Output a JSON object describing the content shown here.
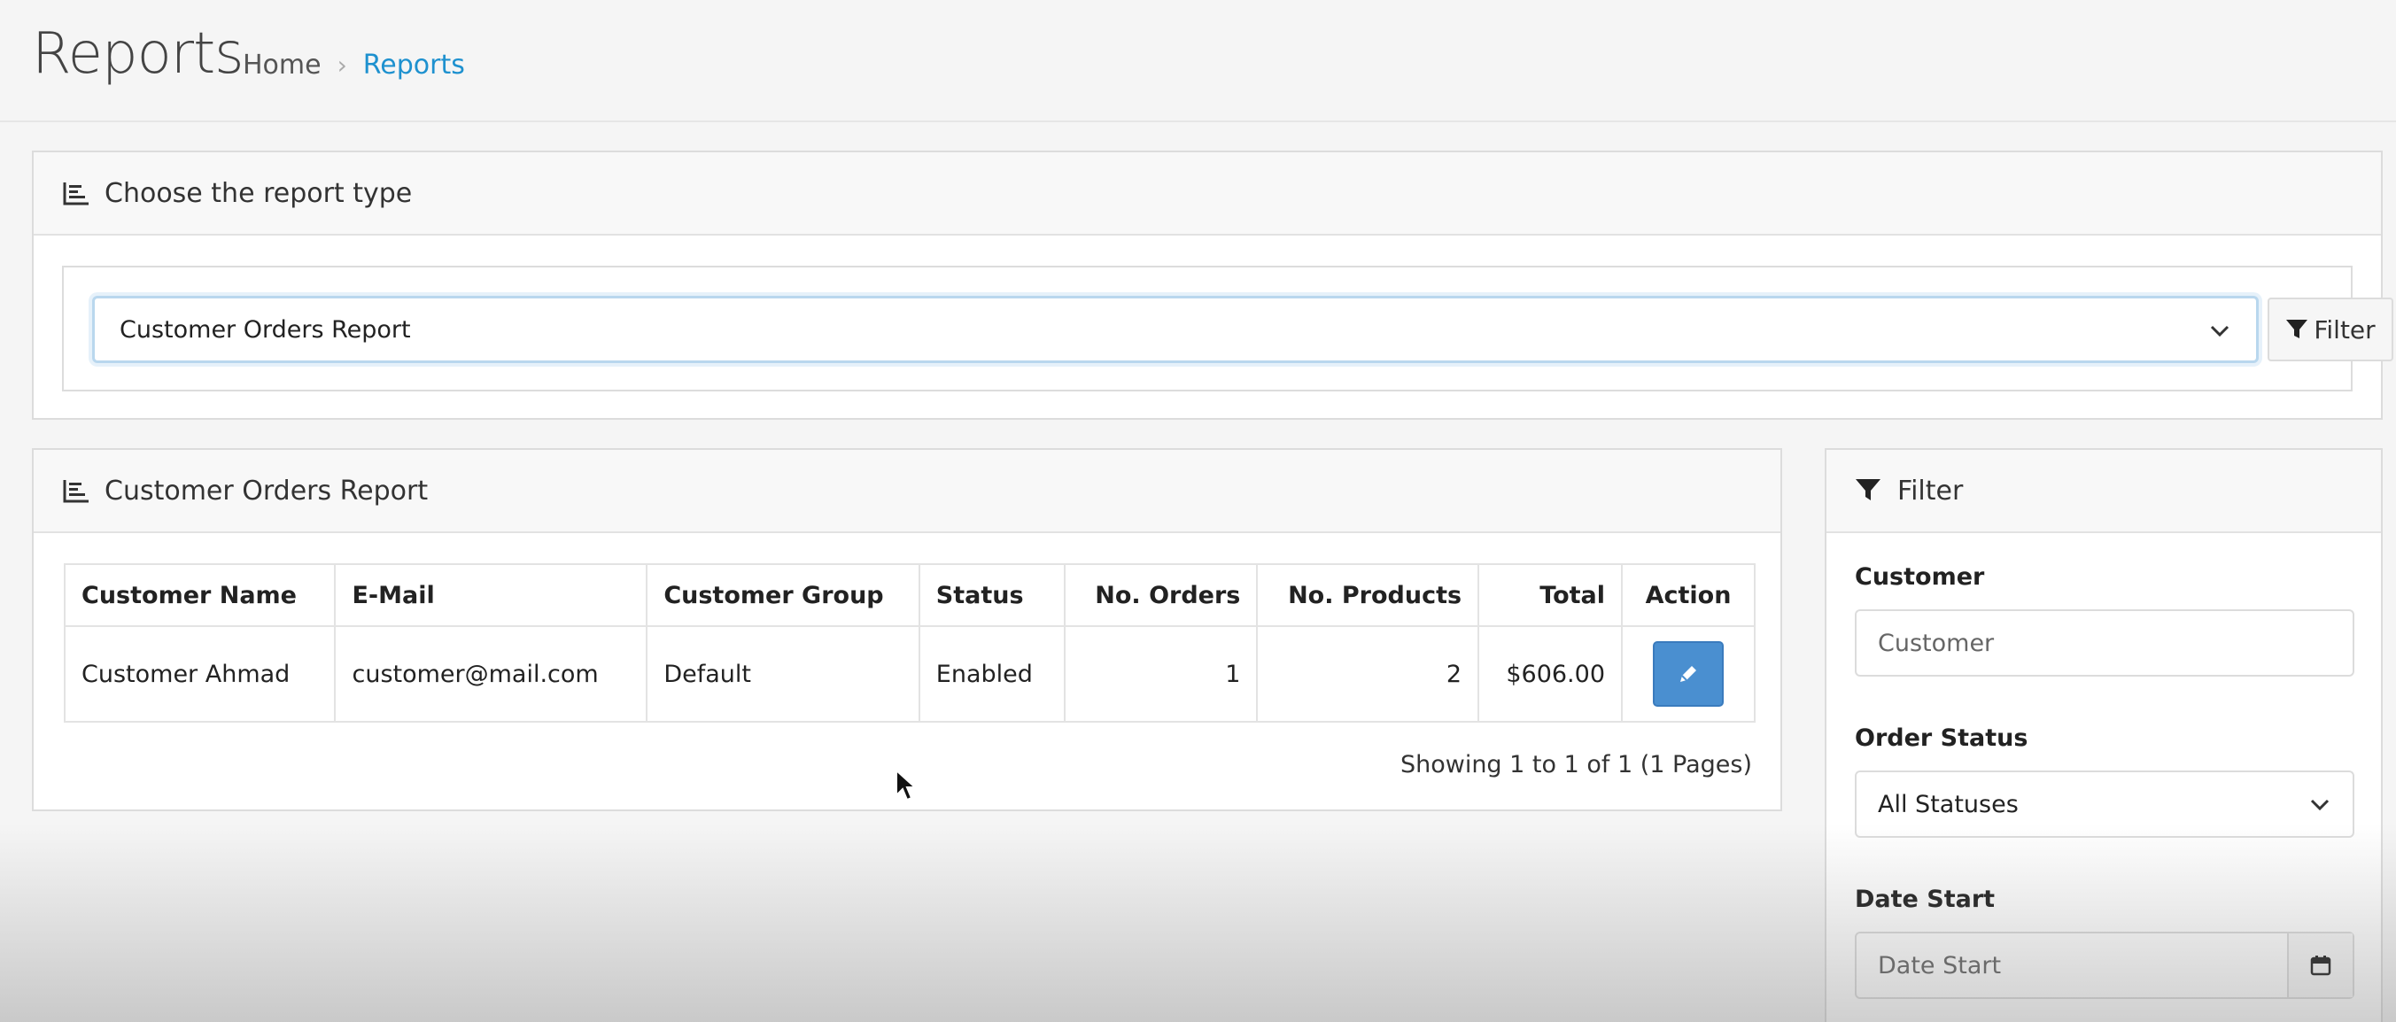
{
  "header": {
    "title": "Reports",
    "breadcrumb": {
      "home": "Home",
      "separator": "›",
      "current": "Reports"
    }
  },
  "report_type_panel": {
    "heading": "Choose the report type",
    "selected_report": "Customer Orders Report",
    "filter_button": "Filter"
  },
  "orders_panel": {
    "heading": "Customer Orders Report",
    "columns": [
      "Customer Name",
      "E-Mail",
      "Customer Group",
      "Status",
      "No. Orders",
      "No. Products",
      "Total",
      "Action"
    ],
    "rows": [
      {
        "customer_name": "Customer Ahmad",
        "email": "customer@mail.com",
        "group": "Default",
        "status": "Enabled",
        "orders": "1",
        "products": "2",
        "total": "$606.00"
      }
    ],
    "pagination": "Showing 1 to 1 of 1 (1 Pages)"
  },
  "filter_panel": {
    "heading": "Filter",
    "customer_label": "Customer",
    "customer_placeholder": "Customer",
    "order_status_label": "Order Status",
    "order_status_value": "All Statuses",
    "date_start_label": "Date Start",
    "date_start_placeholder": "Date Start"
  },
  "colors": {
    "accent": "#1e91cf",
    "edit_button": "#4a8fd0",
    "background": "#f5f5f5"
  },
  "icons": [
    "chart-icon",
    "chevron-down-icon",
    "filter-icon",
    "pencil-icon",
    "calendar-icon",
    "cursor-icon"
  ]
}
